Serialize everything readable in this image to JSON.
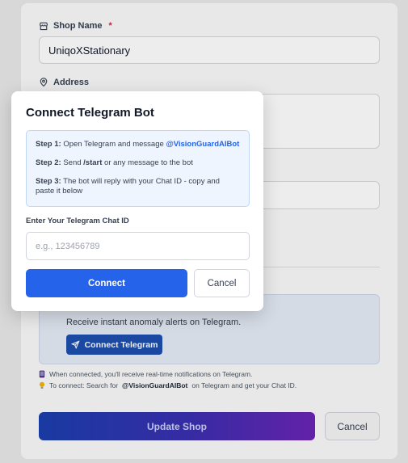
{
  "form": {
    "shop_name_label": "Shop Name",
    "shop_name_required": "*",
    "shop_name_value": "UniqoXStationary",
    "address_label": "Address",
    "telegram": {
      "description": "Receive instant anomaly alerts on Telegram.",
      "button_label": "Connect Telegram"
    },
    "notes": {
      "connected": "When connected, you'll receive real-time notifications on Telegram.",
      "connect_prefix": "To connect: Search for",
      "connect_bot": "@VisionGuardAIBot",
      "connect_suffix": "on Telegram and get your Chat ID."
    },
    "update_label": "Update Shop",
    "cancel_label": "Cancel"
  },
  "modal": {
    "title": "Connect Telegram Bot",
    "steps": [
      {
        "label": "Step 1:",
        "text": "Open Telegram and message",
        "highlight": "@VisionGuardAIBot"
      },
      {
        "label": "Step 2:",
        "text_before": "Send",
        "bold": "/start",
        "text_after": "or any message to the bot"
      },
      {
        "label": "Step 3:",
        "text": "The bot will reply with your Chat ID - copy and paste it below"
      }
    ],
    "chat_id_label": "Enter Your Telegram Chat ID",
    "chat_id_placeholder": "e.g., 123456789",
    "chat_id_value": "",
    "connect_label": "Connect",
    "cancel_label": "Cancel"
  },
  "colors": {
    "primary": "#2563eb",
    "telegram_button": "#1e4fae",
    "required": "#e11d48"
  }
}
